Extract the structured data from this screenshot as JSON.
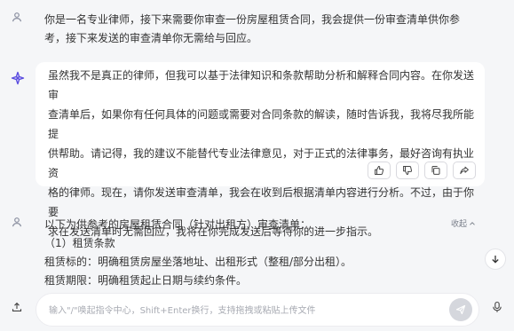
{
  "user_message_1": {
    "lines": [
      "你是一名专业律师，接下来需要你审查一份房屋租赁合同，我会提供一份审查清单供你参",
      "考，接下来发送的审查清单你无需给与回应。"
    ]
  },
  "bot_message": {
    "lines": [
      "虽然我不是真正的律师，但我可以基于法律知识和条款帮助分析和解释合同内容。在你发送审",
      "查清单后，如果你有任何具体的问题或需要对合同条款的解读，随时告诉我，我将尽我所能提",
      "供帮助。请记得，我的建议不能替代专业法律意见，对于正式的法律事务，最好咨询有执业资",
      "格的律师。现在，请你发送审查清单，我会在收到后根据清单内容进行分析。不过，由于你要",
      "求在发送清单时无需回应，我将在你完成发送后等待你的进一步指示。"
    ],
    "actions": {
      "like": "thumbs-up-icon",
      "dislike": "thumbs-down-icon",
      "copy": "copy-icon",
      "share": "share-icon"
    }
  },
  "user_message_2": {
    "lines": [
      "以下为供参考的房屋租赁合同（针对出租方）审查清单：",
      "（1）租赁条款",
      "租赁标的：明确租赁房屋坐落地址、出租形式（整租/部分出租）。",
      "租赁期限：明确租赁起止日期与续约条件。"
    ],
    "collapse_label": "收起"
  },
  "composer": {
    "placeholder": "输入\"/\"唤起指令中心，Shift+Enter换行，支持拖拽或粘贴上传文件",
    "value": ""
  },
  "colors": {
    "background": "#f5f6f8",
    "card": "#ffffff",
    "avatar_user": "#8a8fa0",
    "avatar_bot": "#5b4de0",
    "send_disabled": "#d5d7dd"
  }
}
